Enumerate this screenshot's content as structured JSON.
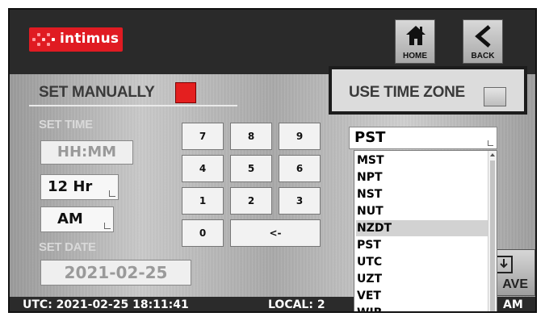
{
  "header": {
    "logo_text": "intimus",
    "home_label": "HOME",
    "back_label": "BACK"
  },
  "manual": {
    "label": "SET MANUALLY",
    "checked": true,
    "set_time_label": "SET TIME",
    "time_placeholder": "HH:MM",
    "hour_format": "12 Hr",
    "meridiem": "AM",
    "set_date_label": "SET DATE",
    "date_value": "2021-02-25"
  },
  "keypad": {
    "keys": [
      "7",
      "8",
      "9",
      "4",
      "5",
      "6",
      "1",
      "2",
      "3",
      "0",
      "<-"
    ]
  },
  "timezone": {
    "label": "USE TIME ZONE",
    "checked": false,
    "selected": "PST",
    "options": [
      "MST",
      "NPT",
      "NST",
      "NUT",
      "NZDT",
      "PST",
      "UTC",
      "UZT",
      "VET",
      "WIB"
    ],
    "highlighted": "NZDT"
  },
  "save": {
    "label": "AVE"
  },
  "footer": {
    "utc": "UTC: 2021-02-25 18:11:41",
    "local_prefix": "LOCAL: 2",
    "local_suffix": "AM"
  },
  "colors": {
    "accent_red": "#e41f1f",
    "logo_red": "#e01b22",
    "header_bg": "#2a2a2a",
    "footer_bg": "#2b2b2b"
  }
}
